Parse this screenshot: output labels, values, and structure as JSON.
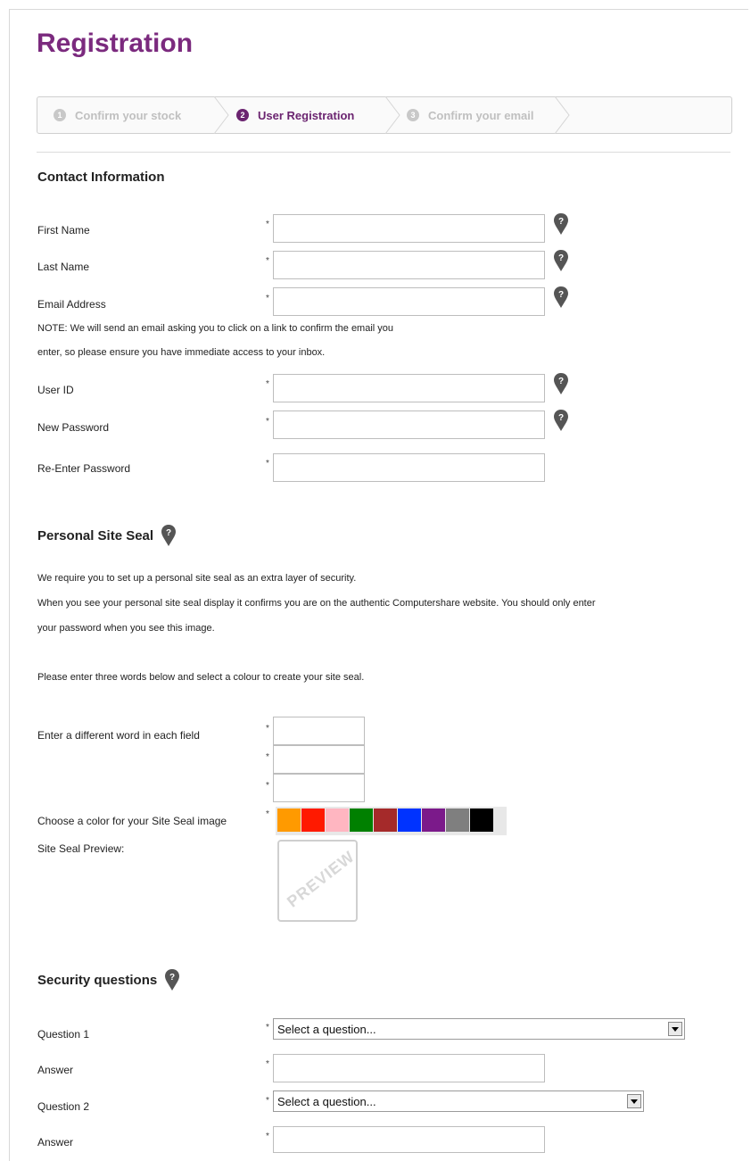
{
  "page": {
    "title": "Registration"
  },
  "steps": [
    {
      "number": "1",
      "label": "Confirm your stock",
      "state": "done"
    },
    {
      "number": "2",
      "label": "User Registration",
      "state": "active"
    },
    {
      "number": "3",
      "label": "Confirm your email",
      "state": "pending"
    }
  ],
  "contact": {
    "heading": "Contact Information",
    "first_name": "First Name",
    "last_name": "Last Name",
    "email": "Email Address",
    "note_line1": "NOTE: We will send an email asking you to click on a link to confirm the email you",
    "note_line2": "enter, so please ensure you have immediate access to your inbox.",
    "user_id": "User ID",
    "new_password": "New Password",
    "reenter_password": "Re-Enter Password",
    "required_mark": "*"
  },
  "site_seal": {
    "heading": "Personal Site Seal",
    "desc1": "We require you to set up a personal site seal as an extra layer of security.",
    "desc2": "When you see your personal site seal display it confirms you are on the authentic Computershare website. You should only enter",
    "desc3": "your password when you see this image.",
    "desc4": "Please enter three words below and select a colour to create your site seal.",
    "words_label": "Enter a different word in each field",
    "color_label": "Choose a color for your Site Seal image",
    "preview_label": "Site Seal Preview:",
    "preview_text": "PREVIEW",
    "colors": [
      "#ff9a00",
      "#ff1a00",
      "#ffb6c1",
      "#008000",
      "#a52a2a",
      "#0033ff",
      "#7b1a8a",
      "#7f7f7f",
      "#000000"
    ]
  },
  "security": {
    "heading": "Security questions",
    "question1": "Question 1",
    "answer1": "Answer",
    "question2": "Question 2",
    "answer2": "Answer",
    "select_placeholder": "Select a question..."
  },
  "icons": {
    "help": "help-marker-icon"
  }
}
